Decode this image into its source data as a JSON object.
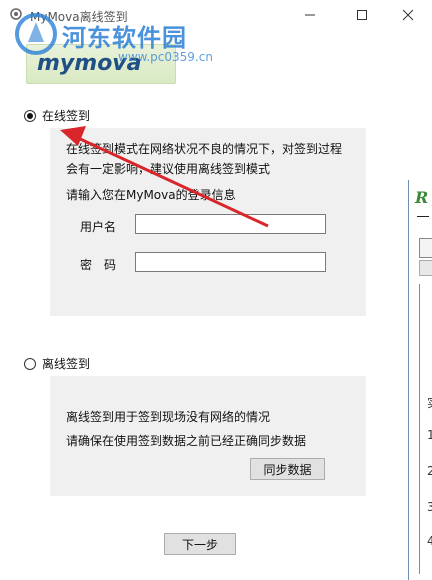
{
  "window": {
    "title": "MyMova离线签到"
  },
  "watermark": {
    "text": "河东软件园",
    "url": "www.pc0359.cn"
  },
  "brand": {
    "logo_text": "mymova"
  },
  "online": {
    "option_label": "在线签到",
    "note_line1": "在线签到模式在网络状况不良的情况下，对签到过程",
    "note_line2": "会有一定影响，建议使用离线签到模式",
    "prompt": "请输入您在MyMova的登录信息",
    "username_label": "用户名",
    "password_label": "密　码",
    "username_value": "",
    "password_value": ""
  },
  "offline": {
    "option_label": "离线签到",
    "note_line1": "离线签到用于签到现场没有网络的情况",
    "note_line2": "请确保在使用签到数据之前已经正确同步数据",
    "sync_button": "同步数据"
  },
  "footer": {
    "next_button": "下一步"
  },
  "background_window": {
    "logo": "R",
    "lines": [
      "实",
      "1",
      "2",
      "3",
      "4"
    ]
  },
  "colors": {
    "arrow": "#d9262b",
    "panel": "#f0f0f0",
    "watermark": "#2b7fd6"
  }
}
